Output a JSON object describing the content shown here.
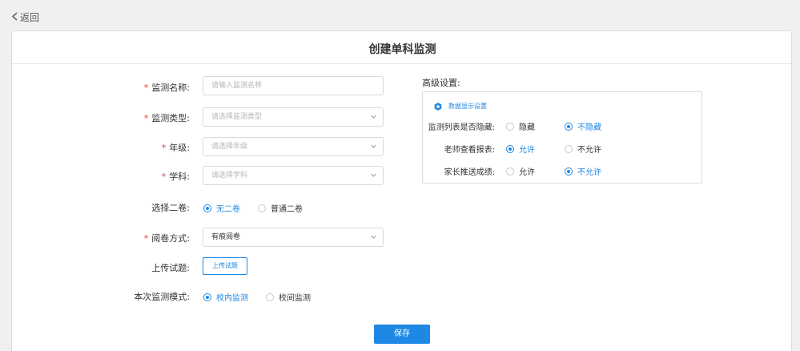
{
  "nav": {
    "back_label": "返回"
  },
  "page": {
    "title": "创建单科监测"
  },
  "form": {
    "name": {
      "label": "监测名称:",
      "placeholder": "请输入监测名称"
    },
    "type": {
      "label": "监测类型:",
      "placeholder": "请选择监测类型"
    },
    "grade": {
      "label": "年级:",
      "placeholder": "请选择年级"
    },
    "subject": {
      "label": "学科:",
      "placeholder": "请选择学科"
    },
    "second_paper": {
      "label": "选择二卷:",
      "options": [
        "无二卷",
        "普通二卷"
      ],
      "selected": "无二卷"
    },
    "marking": {
      "label": "阅卷方式:",
      "value": "有痕阅卷"
    },
    "upload": {
      "label": "上传试题:",
      "button": "上传试题"
    },
    "mode": {
      "label": "本次监测模式:",
      "options": [
        "校内监测",
        "校间监测"
      ],
      "selected": "校内监测"
    },
    "required_mark": "*",
    "save": "保存"
  },
  "advanced": {
    "title": "高级设置:",
    "section": "数据显示设置",
    "rows": [
      {
        "label": "监测列表是否隐藏:",
        "options": [
          "隐藏",
          "不隐藏"
        ],
        "selected": "不隐藏"
      },
      {
        "label": "老师查看报表:",
        "options": [
          "允许",
          "不允许"
        ],
        "selected": "允许"
      },
      {
        "label": "家长推送成绩:",
        "options": [
          "允许",
          "不允许"
        ],
        "selected": "不允许"
      }
    ]
  },
  "colors": {
    "accent": "#1e88e5",
    "required": "#e53935"
  },
  "icons": {
    "back": "chevron-left-icon",
    "dropdown": "chevron-down-icon",
    "settings": "gear-icon"
  }
}
